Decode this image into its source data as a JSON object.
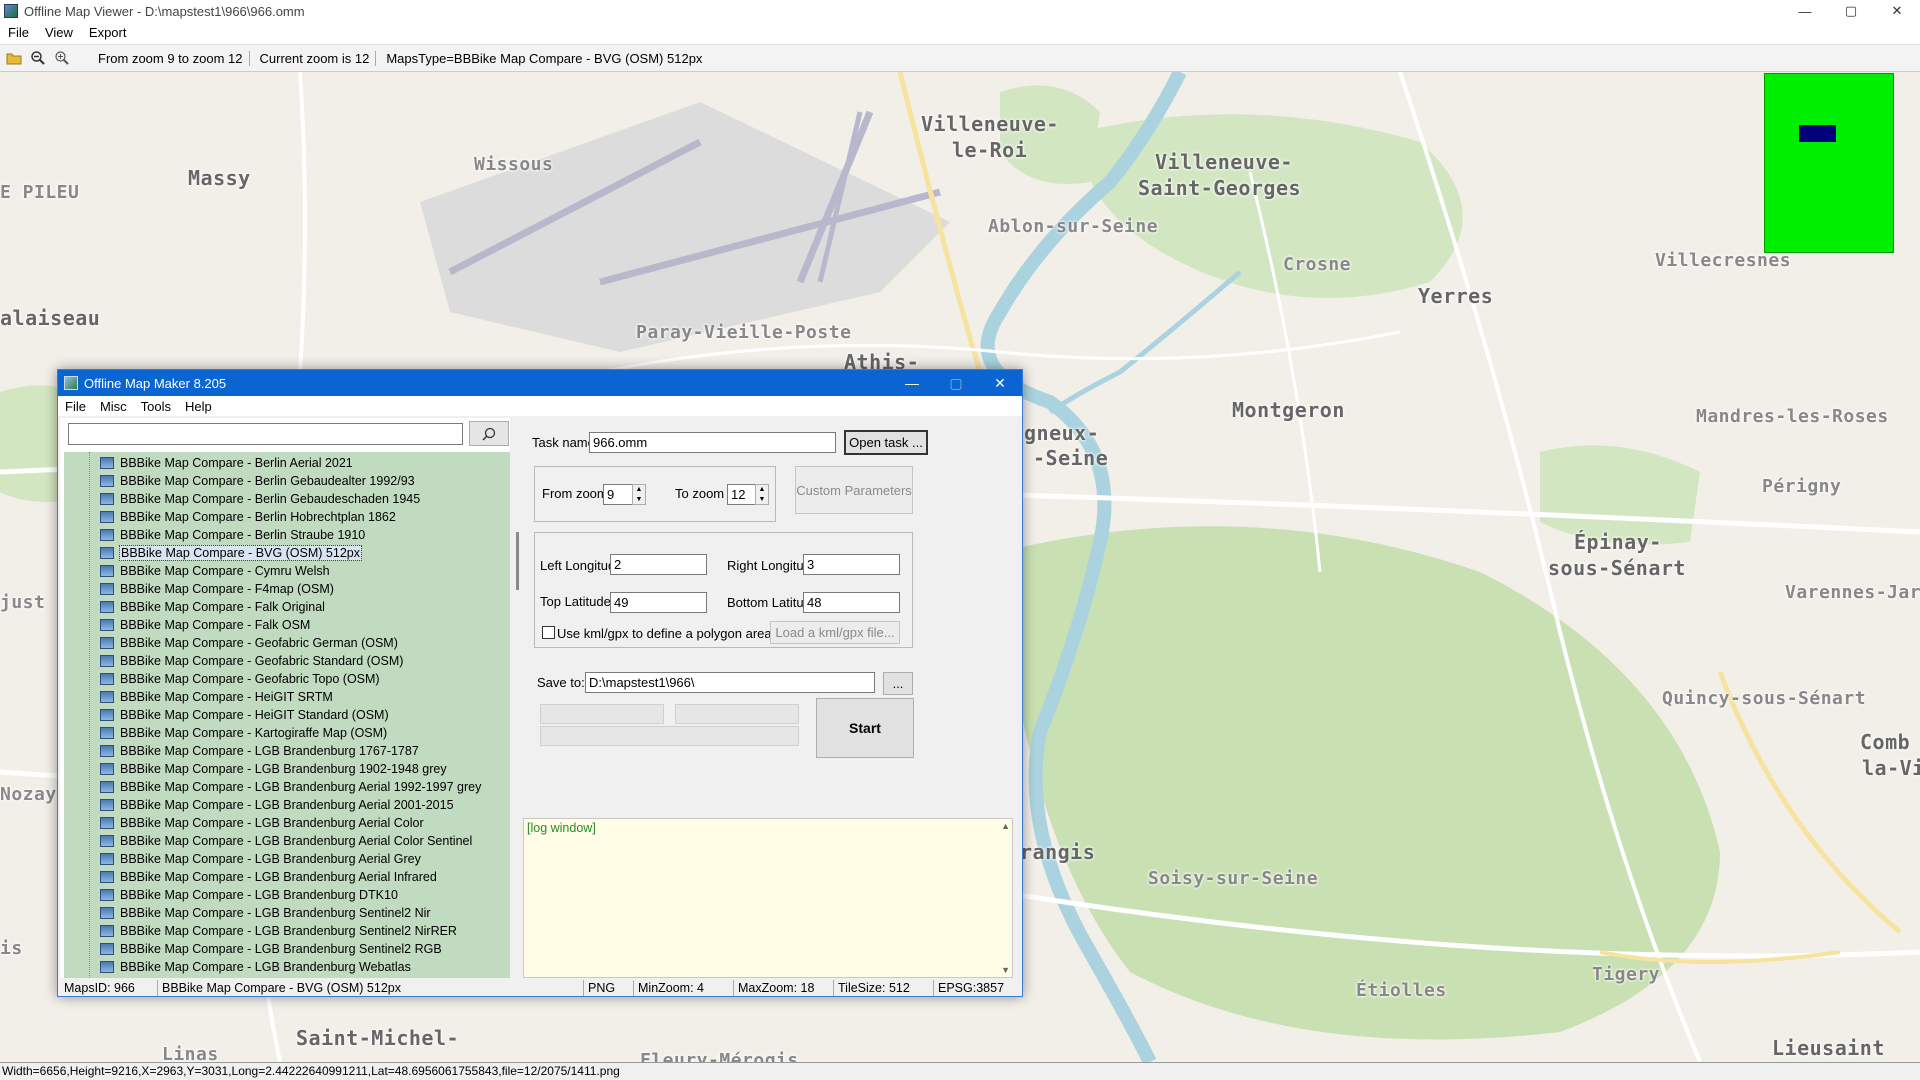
{
  "window": {
    "title": "Offline Map Viewer - D:\\mapstest1\\966\\966.omm",
    "min": "—",
    "max": "▢",
    "close": "✕"
  },
  "menu": [
    "File",
    "View",
    "Export"
  ],
  "toolbar": {
    "zoom_range": "From zoom 9 to zoom 12",
    "current_zoom": "Current zoom is 12",
    "maps_type": "MapsType=BBBike Map Compare - BVG (OSM) 512px"
  },
  "map": {
    "places": [
      {
        "name": "Massy",
        "small": false
      },
      {
        "name": "Wissous",
        "small": true
      },
      {
        "name": "Villeneuve-",
        "small": false
      },
      {
        "name": "le-Roi",
        "small": false
      },
      {
        "name": "Villeneuve-",
        "small": false
      },
      {
        "name": "Saint-Georges",
        "small": false
      },
      {
        "name": "Ablon-sur-Seine",
        "small": true
      },
      {
        "name": "Crosne",
        "small": true
      },
      {
        "name": "Yerres",
        "small": false
      },
      {
        "name": "Villecresnes",
        "small": true
      },
      {
        "name": "E PILEU",
        "small": true
      },
      {
        "name": "alaiseau",
        "small": false
      },
      {
        "name": "Paray-Vieille-Poste",
        "small": true
      },
      {
        "name": "Athis-",
        "small": false
      },
      {
        "name": "Montgeron",
        "small": false
      },
      {
        "name": "Mandres-les-Roses",
        "small": true
      },
      {
        "name": "gneux-",
        "small": false
      },
      {
        "name": "-Seine",
        "small": false
      },
      {
        "name": "Périgny",
        "small": true
      },
      {
        "name": "Épinay-",
        "small": false
      },
      {
        "name": "sous-Sénart",
        "small": false
      },
      {
        "name": "Varennes-Jar",
        "small": true
      },
      {
        "name": "just",
        "small": true
      },
      {
        "name": "Quincy-sous-Sénart",
        "small": true
      },
      {
        "name": "Comb",
        "small": false
      },
      {
        "name": "la-Vi",
        "small": false
      },
      {
        "name": "Nozay",
        "small": true
      },
      {
        "name": "rangis",
        "small": false
      },
      {
        "name": "Soisy-sur-Seine",
        "small": true
      },
      {
        "name": "Tigery",
        "small": true
      },
      {
        "name": "Étiolles",
        "small": true
      },
      {
        "name": "is",
        "small": true
      },
      {
        "name": "Saint-Michel-",
        "small": false
      },
      {
        "name": "Linas",
        "small": true
      },
      {
        "name": "Fleury-Mérogis",
        "small": true
      },
      {
        "name": "Lieusaint",
        "small": false
      }
    ],
    "colors": {
      "land": "#f2efe9",
      "forest": "#c8e0b2",
      "water": "#aad3df",
      "road": "#ffffff",
      "airport": "#c8c8d8"
    }
  },
  "statusbar": "Width=6656,Height=9216,X=2963,Y=3031,Long=2.44222640991211,Lat=48.6956061755843,file=12/2075/1411.png",
  "dialog": {
    "title": "Offline Map Maker 8.205",
    "menu": [
      "File",
      "Misc",
      "Tools",
      "Help"
    ],
    "search_value": "",
    "maps": [
      "BBBike Map Compare - Berlin Aerial 2021",
      "BBBike Map Compare - Berlin Gebaudealter 1992/93",
      "BBBike Map Compare - Berlin Gebaudeschaden 1945",
      "BBBike Map Compare - Berlin Hobrechtplan 1862",
      "BBBike Map Compare - Berlin Straube 1910",
      "BBBike Map Compare - BVG (OSM) 512px",
      "BBBike Map Compare - Cymru Welsh",
      "BBBike Map Compare - F4map (OSM)",
      "BBBike Map Compare - Falk Original",
      "BBBike Map Compare - Falk OSM",
      "BBBike Map Compare - Geofabric German (OSM)",
      "BBBike Map Compare - Geofabric Standard (OSM)",
      "BBBike Map Compare - Geofabric Topo (OSM)",
      "BBBike Map Compare - HeiGIT SRTM",
      "BBBike Map Compare - HeiGIT Standard (OSM)",
      "BBBike Map Compare - Kartogiraffe Map (OSM)",
      "BBBike Map Compare - LGB Brandenburg 1767-1787",
      "BBBike Map Compare - LGB Brandenburg 1902-1948 grey",
      "BBBike Map Compare - LGB Brandenburg Aerial 1992-1997 grey",
      "BBBike Map Compare - LGB Brandenburg Aerial 2001-2015",
      "BBBike Map Compare - LGB Brandenburg Aerial Color",
      "BBBike Map Compare - LGB Brandenburg Aerial Color Sentinel",
      "BBBike Map Compare - LGB Brandenburg Aerial Grey",
      "BBBike Map Compare - LGB Brandenburg Aerial Infrared",
      "BBBike Map Compare - LGB Brandenburg DTK10",
      "BBBike Map Compare - LGB Brandenburg Sentinel2 Nir",
      "BBBike Map Compare - LGB Brandenburg Sentinel2 NirRER",
      "BBBike Map Compare - LGB Brandenburg Sentinel2 RGB",
      "BBBike Map Compare - LGB Brandenburg Webatlas"
    ],
    "selected_index": 5,
    "task_name_label": "Task name",
    "task_name": "966.omm",
    "open_task": "Open task ...",
    "from_zoom_label": "From zoom",
    "from_zoom": "9",
    "to_zoom_label": "To zoom",
    "to_zoom": "12",
    "custom_params": "Custom Parameters",
    "left_lon_label": "Left Longitude",
    "left_lon": "2",
    "right_lon_label": "Right Longitude",
    "right_lon": "3",
    "top_lat_label": "Top Latitude",
    "top_lat": "49",
    "bottom_lat_label": "Bottom Latitude",
    "bottom_lat": "48",
    "kml_label": "Use kml/gpx to define a polygon area",
    "load_kml": "Load a kml/gpx file...",
    "save_to_label": "Save to:",
    "save_to": "D:\\mapstest1\\966\\",
    "browse": "...",
    "start": "Start",
    "log": "[log window]",
    "status": {
      "maps_id": "MapsID: 966",
      "maps_name": "BBBike Map Compare - BVG (OSM) 512px",
      "format": "PNG",
      "min_zoom": "MinZoom: 4",
      "max_zoom": "MaxZoom: 18",
      "tile_size": "TileSize: 512",
      "epsg": "EPSG:3857"
    }
  }
}
